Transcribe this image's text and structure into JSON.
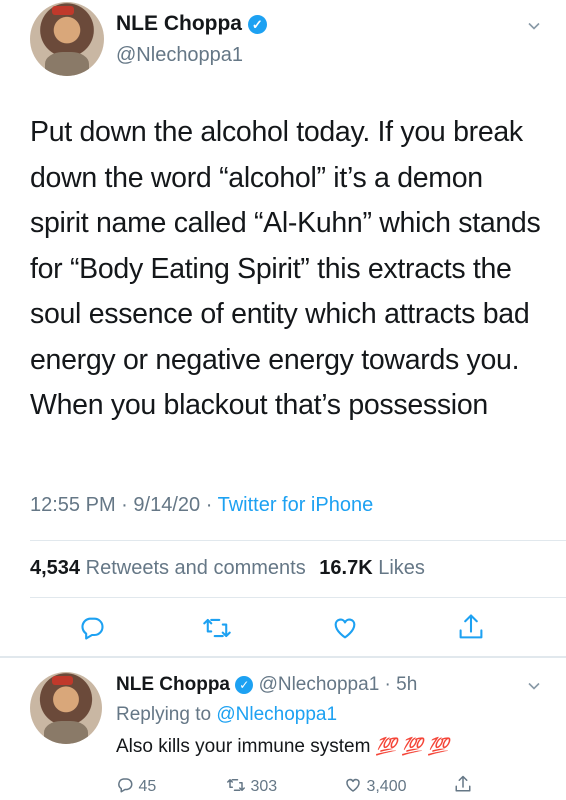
{
  "tweet": {
    "name": "NLE Choppa",
    "handle": "@Nlechoppa1",
    "body": "Put down the alcohol today. If you break down the word “alcohol” it’s a demon spirit name called “Al-Kuhn” which stands for “Body Eating Spirit” this extracts the soul essence of entity which attracts bad energy or negative energy towards you. When you blackout that’s possession",
    "time": "12:55 PM",
    "date": "9/14/20",
    "sep": "·",
    "source": "Twitter for iPhone",
    "retweets_count": "4,534",
    "retweets_label": "Retweets and comments",
    "likes_count": "16.7K",
    "likes_label": "Likes"
  },
  "reply": {
    "name": "NLE Choppa",
    "handle": "@Nlechoppa1",
    "age": "· 5h",
    "replying_prefix": "Replying to",
    "replying_to": "@Nlechoppa1",
    "text": "Also kills your immune system",
    "emoji": "💯 💯 💯",
    "replies": "45",
    "retweets": "303",
    "likes": "3,400"
  },
  "colors": {
    "accent": "#1da1f2",
    "muted": "#657786",
    "divider": "#e1e8ed"
  },
  "icons": [
    "verified-icon",
    "chevron-down-icon",
    "reply-icon",
    "retweet-icon",
    "like-icon",
    "share-icon"
  ]
}
